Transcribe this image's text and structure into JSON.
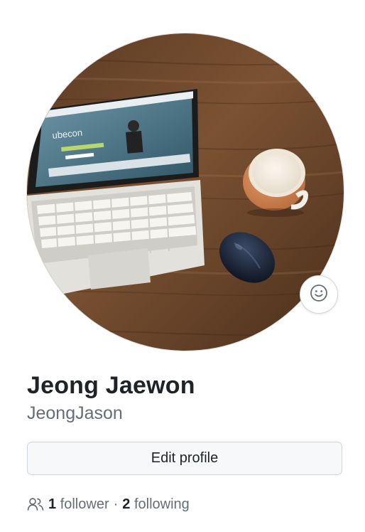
{
  "profile": {
    "full_name": "Jeong Jaewon",
    "username": "JeongJason",
    "avatar_icon": "profile-photo-laptop-coffee-mouse",
    "status_icon": "smiley-icon"
  },
  "actions": {
    "edit_profile_label": "Edit profile"
  },
  "social": {
    "followers_count": "1",
    "followers_label": "follower",
    "separator": "·",
    "following_count": "2",
    "following_label": "following",
    "icon": "people-icon"
  },
  "screen": {
    "laptop_brand_text": "ubecon"
  },
  "colors": {
    "text_primary": "#1f2328",
    "text_muted": "#656d76",
    "button_bg": "#f6f8fa",
    "border": "#d0d7de"
  }
}
